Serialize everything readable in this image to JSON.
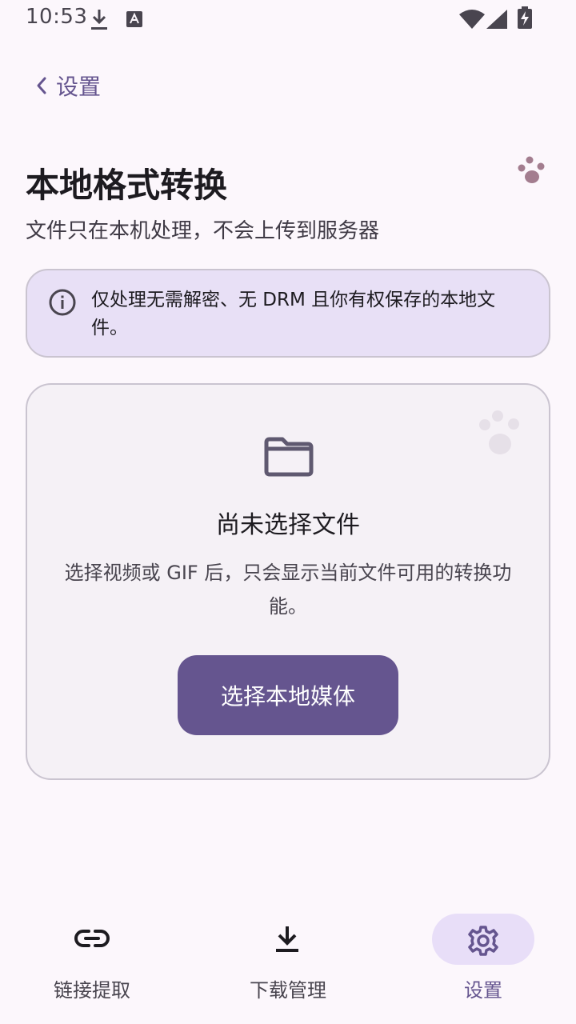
{
  "status_bar": {
    "time": "10:53",
    "icons": [
      "download-icon",
      "a-notification-icon",
      "wifi-icon",
      "signal-icon",
      "battery-charging-icon"
    ]
  },
  "header": {
    "back_label": "设置",
    "title": "本地格式转换",
    "subtitle": "文件只在本机处理，不会上传到服务器"
  },
  "notice": {
    "icon": "info-icon",
    "text": "仅处理无需解密、无 DRM 且你有权保存的本地文件。"
  },
  "picker": {
    "icon": "folder-icon",
    "empty_title": "尚未选择文件",
    "empty_description": "选择视频或 GIF 后，只会显示当前文件可用的转换功能。",
    "button_label": "选择本地媒体"
  },
  "bottom_nav": {
    "items": [
      {
        "label": "链接提取",
        "icon": "link-icon",
        "active": false
      },
      {
        "label": "下载管理",
        "icon": "download-icon",
        "active": false
      },
      {
        "label": "设置",
        "icon": "gear-icon",
        "active": true
      }
    ]
  },
  "colors": {
    "background": "#fcf7fc",
    "accent": "#65558f",
    "notice_bg": "#e8e0f6",
    "card_bg": "#f5f1f6",
    "active_pill": "#e8def8",
    "paw": "#a37d8f"
  }
}
